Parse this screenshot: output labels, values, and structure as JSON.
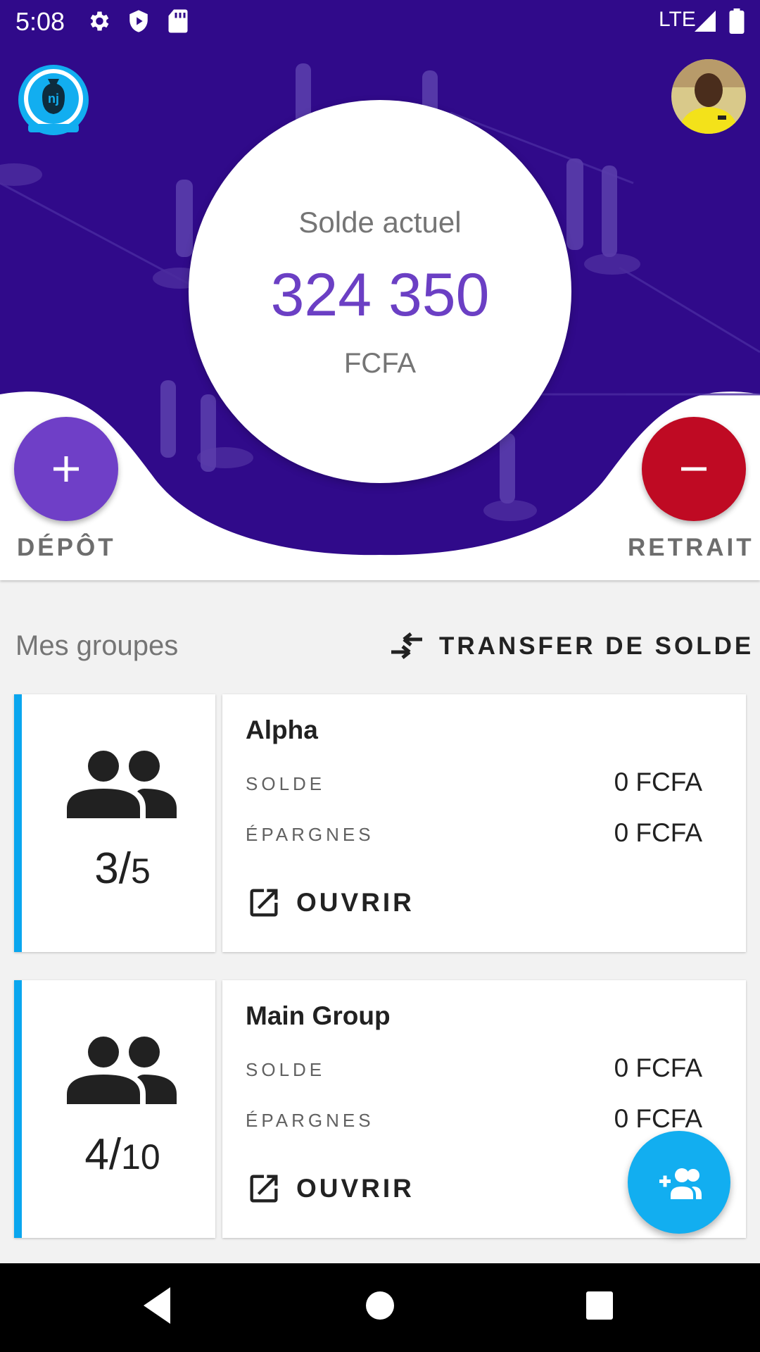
{
  "status_bar": {
    "time": "5:08",
    "network": "LTE",
    "icons": [
      "gear-icon",
      "play-protect-icon",
      "sd-card-icon",
      "signal-icon",
      "battery-icon"
    ]
  },
  "header": {
    "logo_icon": "money-bag-logo-icon",
    "avatar": "user-avatar"
  },
  "balance": {
    "label": "Solde actuel",
    "amount": "324 350",
    "currency": "FCFA"
  },
  "actions": {
    "deposit_label": "DÉPÔT",
    "withdraw_label": "RETRAIT"
  },
  "groups_section": {
    "title": "Mes groupes",
    "transfer_label": "TRANSFER DE SOLDE"
  },
  "groups": [
    {
      "name": "Alpha",
      "members": "3",
      "capacity": "5",
      "balance_label": "SOLDE",
      "balance_value": "0 FCFA",
      "savings_label": "ÉPARGNES",
      "savings_value": "0 FCFA",
      "open_label": "OUVRIR"
    },
    {
      "name": "Main Group",
      "members": "4",
      "capacity": "10",
      "balance_label": "SOLDE",
      "balance_value": "0 FCFA",
      "savings_label": "ÉPARGNES",
      "savings_value": "0 FCFA",
      "open_label": "OUVRIR"
    }
  ],
  "fab": {
    "icon": "add-group-icon"
  },
  "nav_bar": {
    "icons": [
      "back-icon",
      "home-icon",
      "recents-icon"
    ]
  },
  "colors": {
    "hero_purple": "#300a8a",
    "balance_purple": "#6b3fc4",
    "deposit": "#6f3fc7",
    "withdraw": "#bf0a23",
    "accent_blue": "#0aa6ee"
  }
}
